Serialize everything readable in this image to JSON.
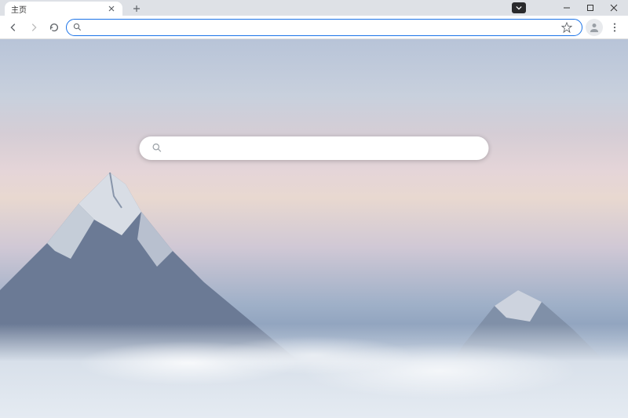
{
  "tab": {
    "title": "主页"
  },
  "omnibox": {
    "value": "",
    "placeholder": ""
  },
  "ntp_search": {
    "value": "",
    "placeholder": ""
  }
}
